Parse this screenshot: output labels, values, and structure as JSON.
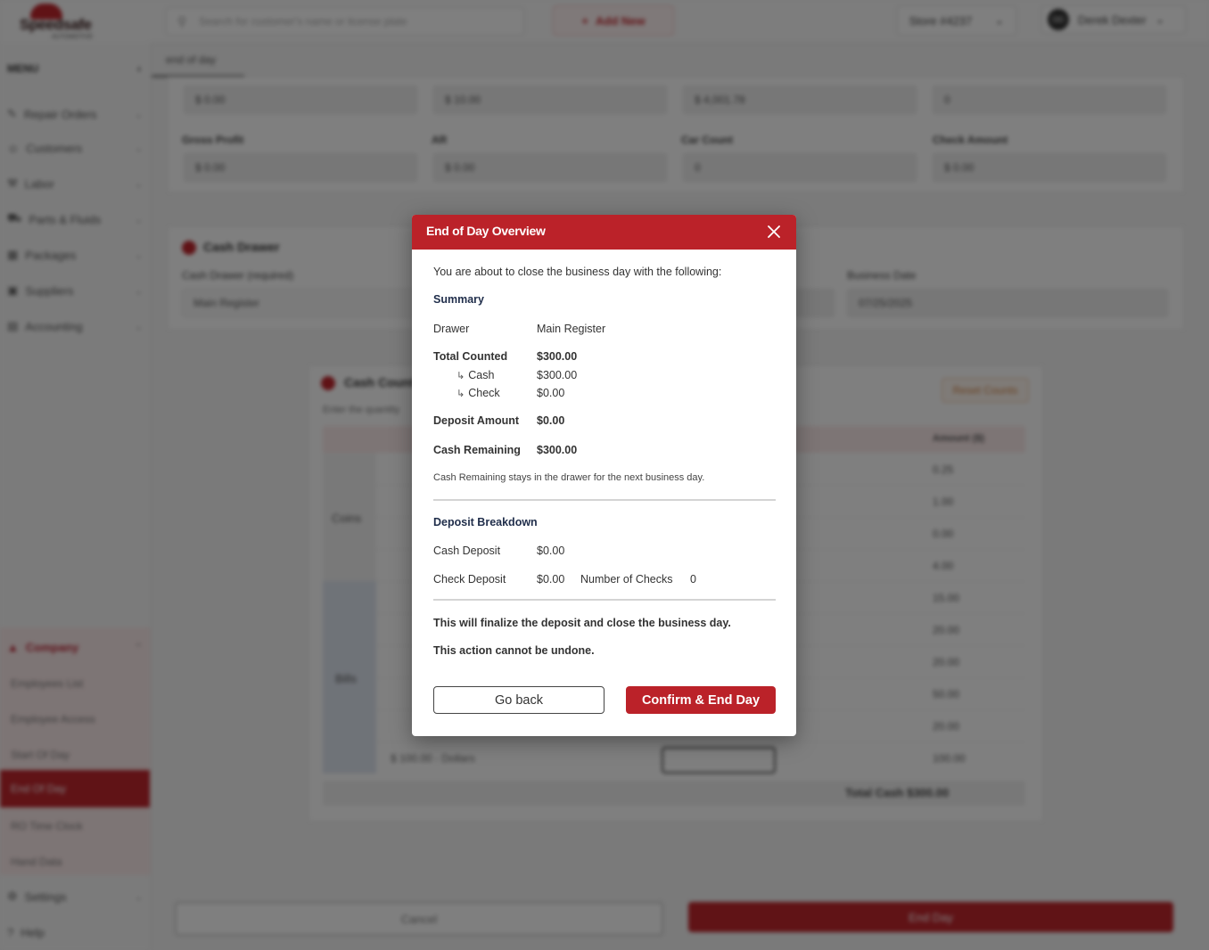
{
  "background": {
    "logo": {
      "word": "Speedsafe",
      "sub": "AUTOMOTIVE"
    },
    "search_placeholder": "Search for customer's name or license plate",
    "add_new_label": "Add New",
    "store_label": "Store #4237",
    "user_initials": "DD",
    "user_name": "Derek Dexter",
    "menu_label": "MENU",
    "sidebar_items": [
      "Repair Orders",
      "Customers",
      "Labor",
      "Parts & Fluids",
      "Packages",
      "Suppliers",
      "Accounting"
    ],
    "company_label": "Company",
    "company_items": [
      "Employees List",
      "Employee Access",
      "Start Of Day",
      "End Of Day",
      "RO Time Clock",
      "Hand Data"
    ],
    "settings_label": "Settings",
    "help_label": "Help",
    "breadcrumb": "end of day",
    "row1_values": [
      "$ 0.00",
      "$ 10.00",
      "$ 4,001.78",
      "0"
    ],
    "row2_labels": [
      "Gross Profit",
      "AR",
      "Car Count",
      "Check Amount"
    ],
    "row2_values": [
      "$ 0.00",
      "$ 0.00",
      "0",
      "$ 0.00"
    ],
    "cash_drawer_title": "Cash Drawer",
    "cash_drawer_label": "Cash Drawer (required)",
    "cash_drawer_value": "Main Register",
    "business_date_label": "Business Date",
    "business_date_value": "07/25/2025",
    "cash_count_title": "Cash Count",
    "cash_count_hint": "Enter the quantity",
    "reset_label": "Reset Counts",
    "amount_header": "Amount ($)",
    "coins_label": "Coins",
    "bills_label": "Bills",
    "amounts": [
      "0.25",
      "1.00",
      "0.00",
      "4.00",
      "15.00",
      "20.00",
      "20.00",
      "50.00",
      "20.00",
      "100.00"
    ],
    "last_row_label": "$ 100.00 - Dollars",
    "total_cash": "Total Cash $300.00",
    "cancel_label": "Cancel",
    "end_day_label": "End Day"
  },
  "modal": {
    "title": "End of Day Overview",
    "intro": "You are about to close the business day with the following:",
    "summary_heading": "Summary",
    "drawer_label": "Drawer",
    "drawer_value": "Main Register",
    "total_counted_label": "Total Counted",
    "total_counted_value": "$300.00",
    "cash_label": "Cash",
    "cash_value": "$300.00",
    "check_label": "Check",
    "check_value": "$0.00",
    "deposit_amount_label": "Deposit Amount",
    "deposit_amount_value": "$0.00",
    "cash_remaining_label": "Cash Remaining",
    "cash_remaining_value": "$300.00",
    "cash_remaining_note": "Cash Remaining stays in the drawer for the next business day.",
    "breakdown_heading": "Deposit Breakdown",
    "cash_deposit_label": "Cash Deposit",
    "cash_deposit_value": "$0.00",
    "check_deposit_label": "Check Deposit",
    "check_deposit_value": "$0.00",
    "num_checks_label": "Number of Checks",
    "num_checks_value": "0",
    "warning1": "This will finalize the deposit and close the business day.",
    "warning2": "This action cannot be undone.",
    "back_label": "Go back",
    "confirm_label": "Confirm & End Day"
  },
  "colors": {
    "brand_red": "#bb2229",
    "heading_navy": "#1f2d4a"
  }
}
